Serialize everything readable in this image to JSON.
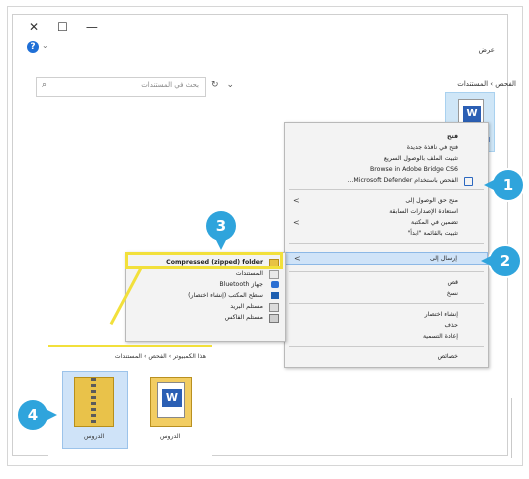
{
  "window": {
    "close_glyph": "✕",
    "maximize_glyph": "☐",
    "minimize_glyph": "—",
    "help_glyph": "?",
    "help_caret": "⌄",
    "view_tab": "عرض"
  },
  "address_bar": {
    "path": "الفحص › المستندات",
    "search_placeholder": "بحث في المستندات",
    "refresh_glyph": "↻",
    "dropdown_glyph": "⌄",
    "search_glyph": "⌕"
  },
  "context_menu": {
    "items": [
      {
        "label": "فتح"
      },
      {
        "label": "فتح في نافذة جديدة"
      },
      {
        "label": "تثبيت الملف بالوصول السريع"
      },
      {
        "label": "Browse in Adobe Bridge CS6"
      },
      {
        "label": "الفحص باستخدام Microsoft Defender..."
      },
      {
        "label": "منح حق الوصول إلى"
      },
      {
        "label": "استعادة الإصدارات السابقة"
      },
      {
        "label": "تضمين في المكتبة"
      },
      {
        "label": "تثبيت بالقائمة \"ابدأ\""
      },
      {
        "label": "إرسال إلى"
      },
      {
        "label": "قص"
      },
      {
        "label": "نسخ"
      },
      {
        "label": "إنشاء اختصار"
      },
      {
        "label": "حذف"
      },
      {
        "label": "إعادة التسمية"
      },
      {
        "label": "خصائص"
      }
    ],
    "submenu_arrow": "<"
  },
  "send_to_submenu": {
    "items": [
      {
        "label": "Compressed (zipped) folder"
      },
      {
        "label": "المستندات"
      },
      {
        "label": "جهاز Bluetooth"
      },
      {
        "label": "سطح المكتب (إنشاء اختصار)"
      },
      {
        "label": "مستلم البريد"
      },
      {
        "label": "مستلم الفاكس"
      }
    ]
  },
  "bottom_panel": {
    "path": "هذا الكمبيوتر › الفحص › المستندات",
    "zip_label": "الدروس",
    "doc_label": "الدروس"
  },
  "badges": [
    "1",
    "2",
    "3",
    "4"
  ],
  "file_icon_letter": "W",
  "colors": {
    "badge": "#2fa4dc",
    "highlight_yellow": "#f2e03b",
    "selection": "#cfe3f8"
  }
}
